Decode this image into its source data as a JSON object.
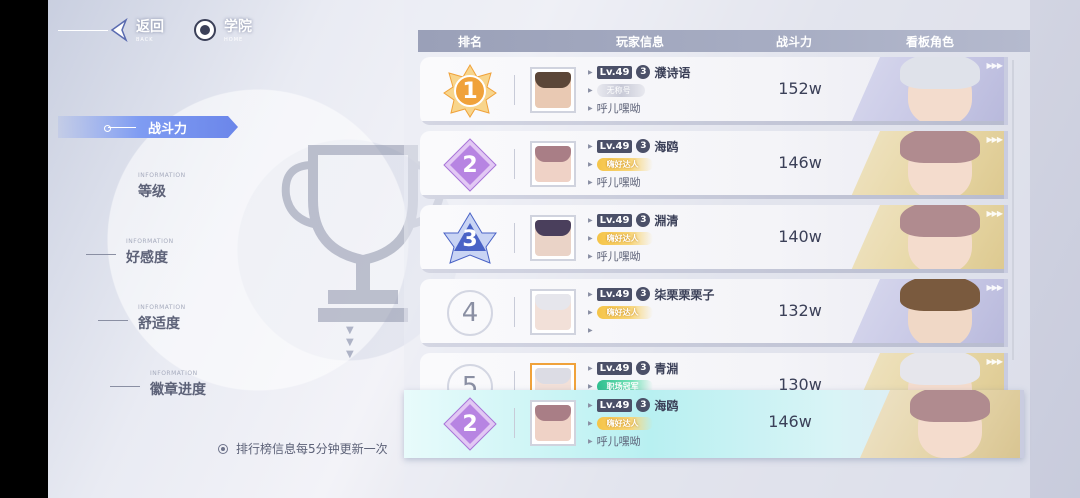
{
  "nav": {
    "back_label": "返回",
    "back_sub": "BACK",
    "home_label": "学院",
    "home_sub": "HOME"
  },
  "menu": {
    "active": "战斗力",
    "items": [
      {
        "en": "INFORMATION",
        "zh": "等级"
      },
      {
        "en": "INFORMATION",
        "zh": "好感度"
      },
      {
        "en": "INFORMATION",
        "zh": "舒适度"
      },
      {
        "en": "INFORMATION",
        "zh": "徽章进度"
      }
    ]
  },
  "note": "排行榜信息每5分钟更新一次",
  "table": {
    "headers": [
      "排名",
      "玩家信息",
      "战斗力",
      "看板角色"
    ],
    "rows": [
      {
        "rank": "1",
        "level": "Lv.49",
        "group": "3",
        "name": "濮诗语",
        "title": "无称号",
        "title_style": "none",
        "greeting": "呼儿嘿呦",
        "power": "152w"
      },
      {
        "rank": "2",
        "level": "Lv.49",
        "group": "3",
        "name": "海鸥",
        "title": "嗨好达人",
        "title_style": "gold",
        "greeting": "呼儿嘿呦",
        "power": "146w"
      },
      {
        "rank": "3",
        "level": "Lv.49",
        "group": "3",
        "name": "淵清",
        "title": "嗨好达人",
        "title_style": "gold",
        "greeting": "呼儿嘿呦",
        "power": "140w"
      },
      {
        "rank": "4",
        "level": "Lv.49",
        "group": "3",
        "name": "柒栗栗栗子",
        "title": "嗨好达人",
        "title_style": "gold",
        "greeting": "",
        "power": "132w"
      },
      {
        "rank": "5",
        "level": "Lv.49",
        "group": "3",
        "name": "青淵",
        "title": "职场冠军",
        "title_style": "green",
        "greeting": "",
        "power": "130w"
      }
    ],
    "self": {
      "rank": "2",
      "level": "Lv.49",
      "group": "3",
      "name": "海鸥",
      "title": "嗨好达人",
      "title_style": "gold",
      "greeting": "呼儿嘿呦",
      "power": "146w"
    }
  },
  "colors": {
    "gold_rank": "#f0a23a",
    "silver_rank": "#a874d8",
    "bronze_rank": "#4a63c6",
    "accent": "#7f9cf2"
  }
}
